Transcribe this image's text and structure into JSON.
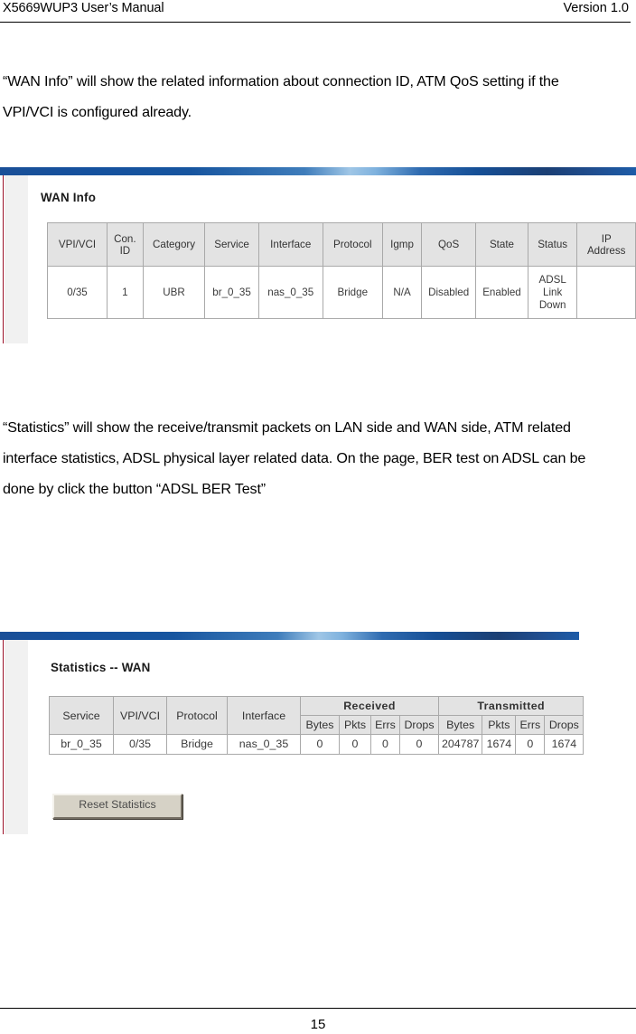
{
  "header": {
    "left_title": "X5669WUP3 User’s Manual",
    "right_version": "Version 1.0"
  },
  "paragraphs": {
    "wan_info": "“WAN Info” will show the related information about connection ID, ATM QoS setting if the VPI/VCI is configured already.",
    "statistics": "“Statistics” will show the receive/transmit packets on LAN side and WAN side, ATM related interface statistics, ADSL physical layer related data. On the page, BER test on ADSL can be done by click the button “ADSL BER Test”"
  },
  "figure_wan_info": {
    "title": "WAN Info",
    "table": {
      "headers": [
        "VPI/VCI",
        "Con. ID",
        "Category",
        "Service",
        "Interface",
        "Protocol",
        "Igmp",
        "QoS",
        "State",
        "Status",
        "IP Address"
      ],
      "rows": [
        {
          "vpi_vci": "0/35",
          "con_id": "1",
          "category": "UBR",
          "service": "br_0_35",
          "interface": "nas_0_35",
          "protocol": "Bridge",
          "igmp": "N/A",
          "qos": "Disabled",
          "state": "Enabled",
          "status": "ADSL Link Down",
          "ip_address": ""
        }
      ]
    }
  },
  "figure_statistics_wan": {
    "title": "Statistics -- WAN",
    "table": {
      "group_headers": {
        "received": "Received",
        "transmitted": "Transmitted"
      },
      "headers": [
        "Service",
        "VPI/VCI",
        "Protocol",
        "Interface"
      ],
      "sub_headers": [
        "Bytes",
        "Pkts",
        "Errs",
        "Drops",
        "Bytes",
        "Pkts",
        "Errs",
        "Drops"
      ],
      "rows": [
        {
          "service": "br_0_35",
          "vpi_vci": "0/35",
          "protocol": "Bridge",
          "interface": "nas_0_35",
          "rx_bytes": "0",
          "rx_pkts": "0",
          "rx_errs": "0",
          "rx_drops": "0",
          "tx_bytes": "204787",
          "tx_pkts": "1674",
          "tx_errs": "0",
          "tx_drops": "1674"
        }
      ]
    },
    "reset_button_label": "Reset Statistics"
  },
  "footer": {
    "page_number": "15"
  }
}
